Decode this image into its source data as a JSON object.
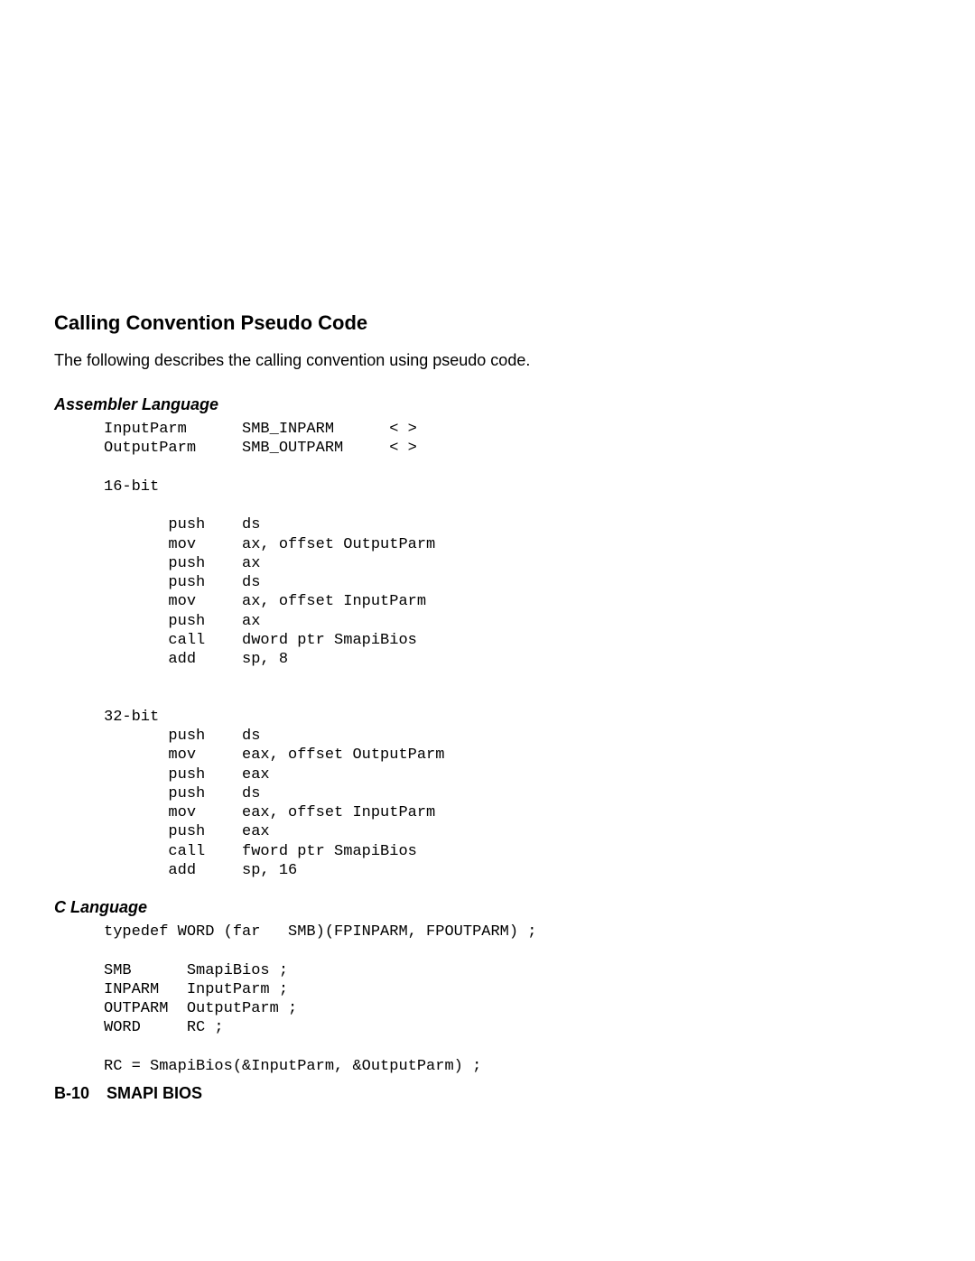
{
  "heading": "Calling Convention Pseudo Code",
  "intro": "The following describes the calling convention using pseudo code.",
  "assembler": {
    "title": "Assembler Language",
    "code": "InputParm      SMB_INPARM      < >\nOutputParm     SMB_OUTPARM     < >\n\n16-bit\n\n       push    ds\n       mov     ax, offset OutputParm\n       push    ax\n       push    ds\n       mov     ax, offset InputParm\n       push    ax\n       call    dword ptr SmapiBios\n       add     sp, 8\n\n\n32-bit\n       push    ds\n       mov     eax, offset OutputParm\n       push    eax\n       push    ds\n       mov     eax, offset InputParm\n       push    eax\n       call    fword ptr SmapiBios\n       add     sp, 16"
  },
  "clang": {
    "title": "C Language",
    "code": "typedef WORD (far   SMB)(FPINPARM, FPOUTPARM) ;\n\nSMB      SmapiBios ;\nINPARM   InputParm ;\nOUTPARM  OutputParm ;\nWORD     RC ;\n\nRC = SmapiBios(&InputParm, &OutputParm) ;"
  },
  "footer": {
    "pageno": "B-10",
    "title": "SMAPI BIOS"
  }
}
